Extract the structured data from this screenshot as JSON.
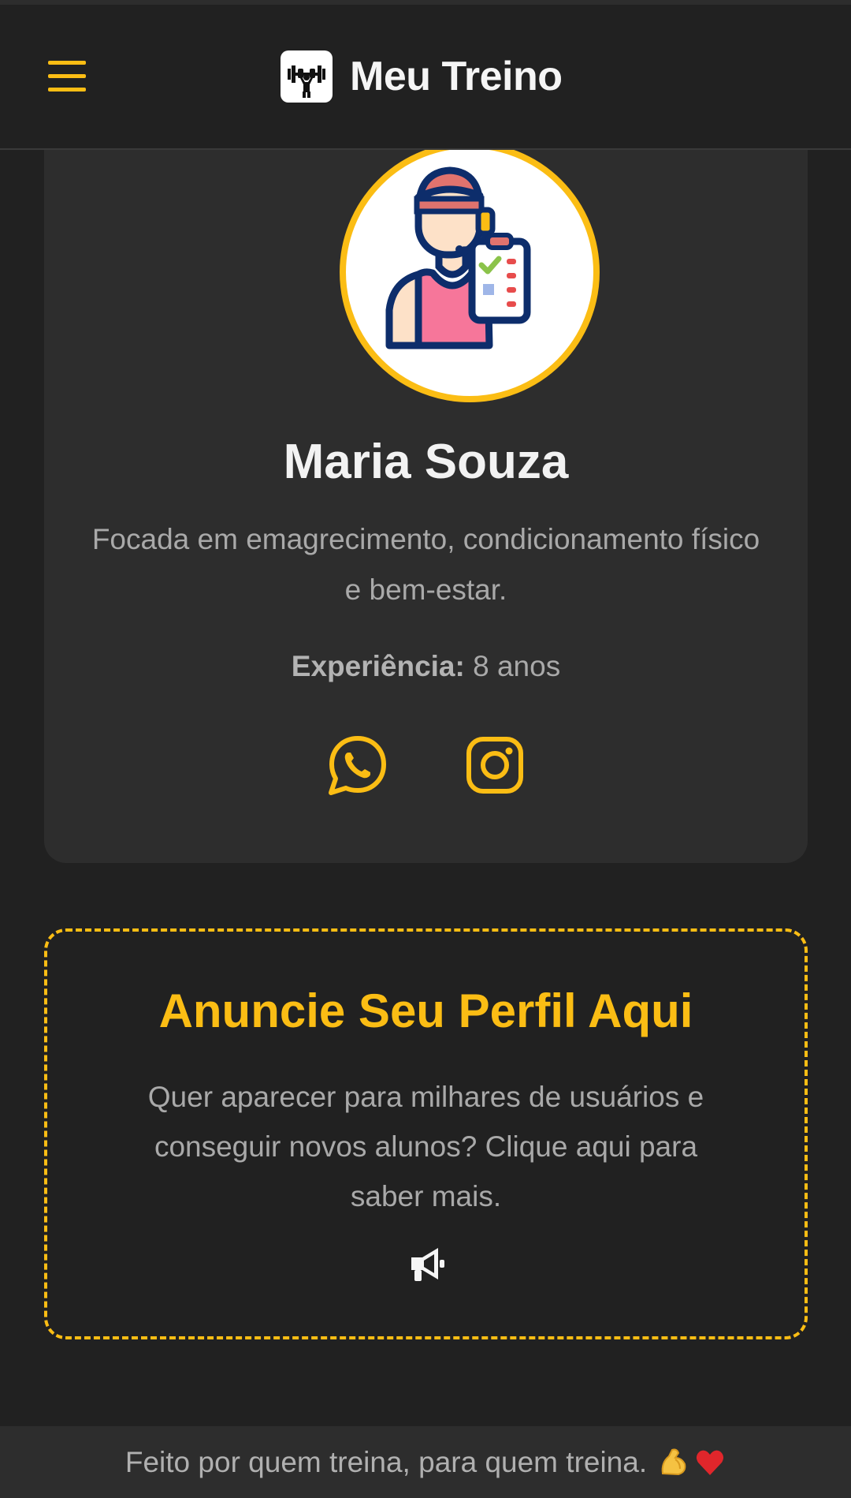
{
  "header": {
    "title": "Meu Treino",
    "menu_icon": "hamburger-menu-icon",
    "logo_icon": "weightlifter-icon"
  },
  "profile": {
    "avatar_icon": "personal-trainer-avatar",
    "name": "Maria Souza",
    "bio": "Focada em emagrecimento, condicionamento físico e bem-estar.",
    "experience_label": "Experiência:",
    "experience_value": "8 anos",
    "social": [
      {
        "name": "whatsapp-icon"
      },
      {
        "name": "instagram-icon"
      }
    ]
  },
  "ad": {
    "title": "Anuncie Seu Perfil Aqui",
    "text": "Quer aparecer para milhares de usuários e conseguir novos alunos? Clique aqui para saber mais.",
    "icon": "megaphone-icon"
  },
  "footer": {
    "text": "Feito por quem treina, para quem treina."
  },
  "colors": {
    "accent": "#fbbd14",
    "background": "#212121",
    "card": "#2d2d2d"
  }
}
